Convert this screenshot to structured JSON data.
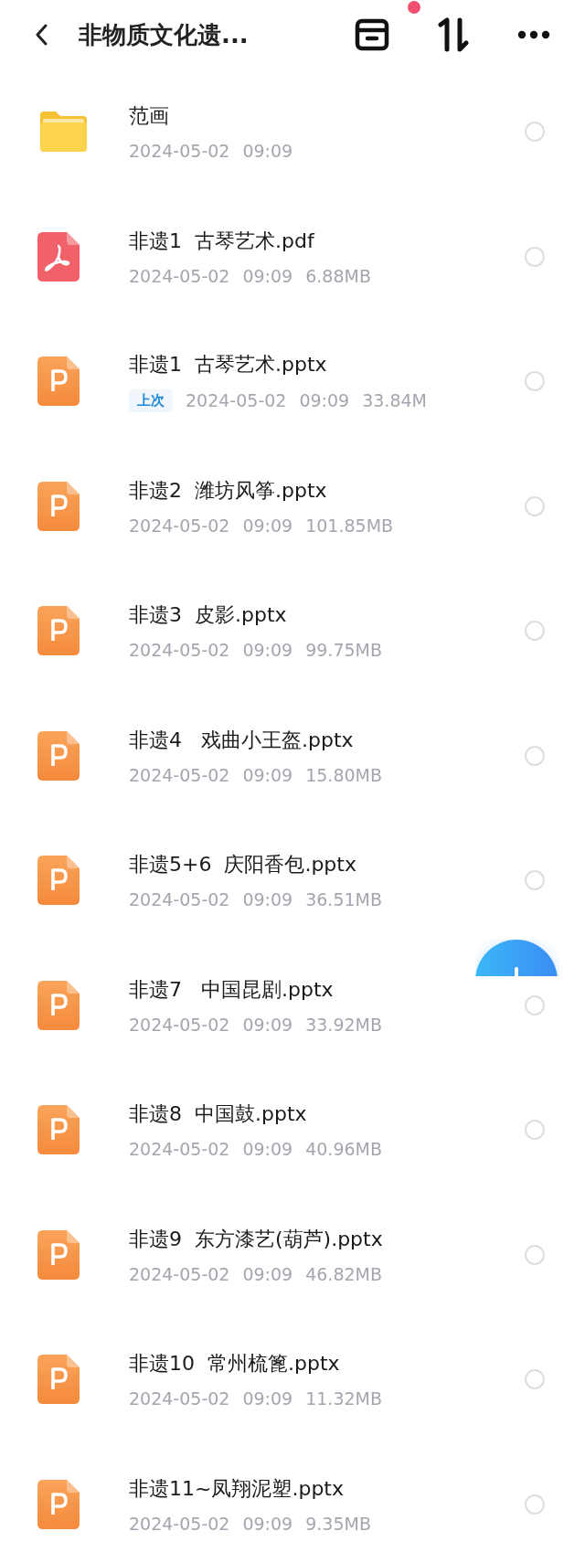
{
  "header": {
    "title": "非物质文化遗...",
    "notification_dot": true
  },
  "files": [
    {
      "kind": "folder",
      "name": "范画",
      "date": "2024-05-02",
      "time": "09:09",
      "selected": false
    },
    {
      "kind": "pdf",
      "name": "非遗1  古琴艺术.pdf",
      "date": "2024-05-02",
      "time": "09:09",
      "size": "6.88MB",
      "selected": false
    },
    {
      "kind": "pptx",
      "name": "非遗1  古琴艺术.pptx",
      "badge": "上次",
      "date": "2024-05-02",
      "time": "09:09",
      "size": "33.84M",
      "selected": false
    },
    {
      "kind": "pptx",
      "name": "非遗2  潍坊风筝.pptx",
      "date": "2024-05-02",
      "time": "09:09",
      "size": "101.85MB",
      "selected": false
    },
    {
      "kind": "pptx",
      "name": "非遗3  皮影.pptx",
      "date": "2024-05-02",
      "time": "09:09",
      "size": "99.75MB",
      "selected": false
    },
    {
      "kind": "pptx",
      "name": "非遗4   戏曲小王盔.pptx",
      "date": "2024-05-02",
      "time": "09:09",
      "size": "15.80MB",
      "selected": false
    },
    {
      "kind": "pptx",
      "name": "非遗5+6  庆阳香包.pptx",
      "date": "2024-05-02",
      "time": "09:09",
      "size": "36.51MB",
      "selected": false
    },
    {
      "kind": "pptx",
      "name": "非遗7   中国昆剧.pptx",
      "date": "2024-05-02",
      "time": "09:09",
      "size": "33.92MB",
      "selected": false
    },
    {
      "kind": "pptx",
      "name": "非遗8  中国鼓.pptx",
      "date": "2024-05-02",
      "time": "09:09",
      "size": "40.96MB",
      "selected": false
    },
    {
      "kind": "pptx",
      "name": "非遗9  东方漆艺(葫芦).pptx",
      "date": "2024-05-02",
      "time": "09:09",
      "size": "46.82MB",
      "selected": false
    },
    {
      "kind": "pptx",
      "name": "非遗10  常州梳篦.pptx",
      "date": "2024-05-02",
      "time": "09:09",
      "size": "11.32MB",
      "selected": false
    },
    {
      "kind": "pptx",
      "name": "非遗11~凤翔泥塑.pptx",
      "date": "2024-05-02",
      "time": "09:09",
      "size": "9.35MB",
      "selected": false
    }
  ]
}
